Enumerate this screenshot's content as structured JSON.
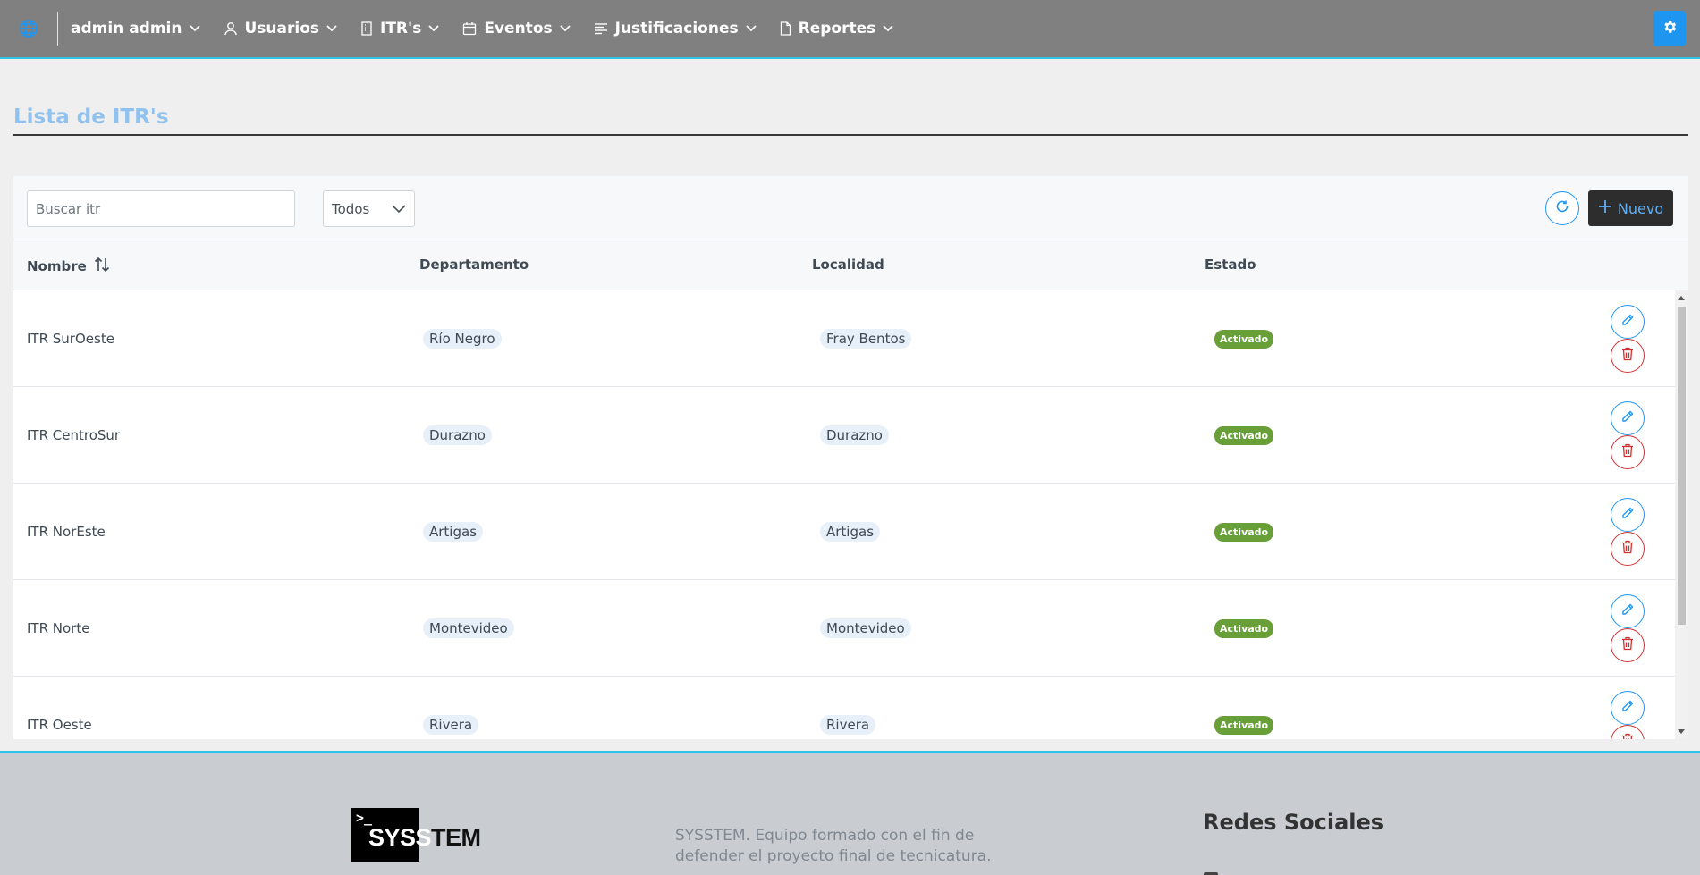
{
  "nav": {
    "user": "admin admin",
    "items": [
      {
        "label": "Usuarios",
        "icon": "user-icon"
      },
      {
        "label": "ITR's",
        "icon": "building-icon"
      },
      {
        "label": "Eventos",
        "icon": "calendar-icon"
      },
      {
        "label": "Justificaciones",
        "icon": "align-left-icon"
      },
      {
        "label": "Reportes",
        "icon": "file-icon"
      }
    ]
  },
  "page": {
    "title": "Lista de ITR's"
  },
  "toolbar": {
    "search_placeholder": "Buscar itr",
    "filter_value": "Todos",
    "new_label": "Nuevo"
  },
  "table": {
    "columns": [
      "Nombre",
      "Departamento",
      "Localidad",
      "Estado"
    ],
    "rows": [
      {
        "nombre": "ITR SurOeste",
        "departamento": "Río Negro",
        "localidad": "Fray Bentos",
        "estado": "Activado"
      },
      {
        "nombre": "ITR CentroSur",
        "departamento": "Durazno",
        "localidad": "Durazno",
        "estado": "Activado"
      },
      {
        "nombre": "ITR NorEste",
        "departamento": "Artigas",
        "localidad": "Artigas",
        "estado": "Activado"
      },
      {
        "nombre": "ITR Norte",
        "departamento": "Montevideo",
        "localidad": "Montevideo",
        "estado": "Activado"
      },
      {
        "nombre": "ITR Oeste",
        "departamento": "Rivera",
        "localidad": "Rivera",
        "estado": "Activado"
      }
    ]
  },
  "footer": {
    "brand_prompt": ">_",
    "brand_name_a": "SYSS",
    "brand_name_b": "TEM",
    "description": "SYSSTEM. Equipo formado con el fin de defender el proyecto final de tecnicatura.",
    "social_title": "Redes Sociales"
  },
  "colors": {
    "nav_bg": "#808080",
    "accent": "#2ec4e6",
    "primary": "#2196f3",
    "danger": "#d32f2f",
    "success": "#689f38",
    "title": "#8fc2ee"
  }
}
